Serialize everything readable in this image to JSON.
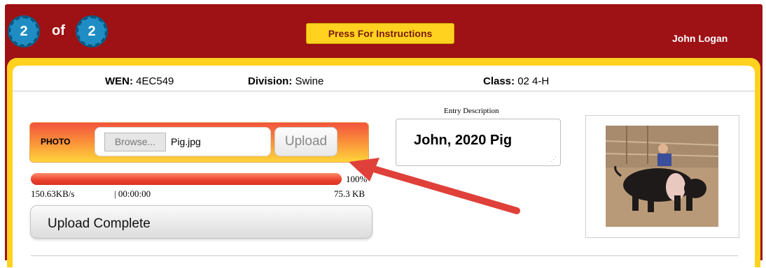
{
  "header": {
    "current": "2",
    "of_label": "of",
    "total": "2",
    "instructions_button": "Press For Instructions",
    "user_name": "John Logan"
  },
  "entry": {
    "wen_label": "WEN:",
    "wen_value": "4EC549",
    "division_label": "Division:",
    "division_value": "Swine",
    "class_label": "Class:",
    "class_value": "02 4-H"
  },
  "upload": {
    "photo_label": "PHOTO",
    "browse_label": "Browse...",
    "file_name": "Pig.jpg",
    "upload_button": "Upload",
    "progress_percent": 100,
    "progress_label": "100%",
    "speed": "150.63KB/s",
    "elapsed": "| 00:00:00",
    "size": "75.3 KB",
    "status": "Upload Complete"
  },
  "description": {
    "label": "Entry Description",
    "value": "John, 2020 Pig"
  },
  "colors": {
    "header_red": "#9e1115",
    "accent_yellow": "#ffd21f",
    "badge_blue": "#1f8dc4",
    "annotation_arrow": "#e0403a"
  },
  "icons": {
    "resize_handle": "resize-grip-icon",
    "annotation": "arrow-annotation-icon"
  }
}
